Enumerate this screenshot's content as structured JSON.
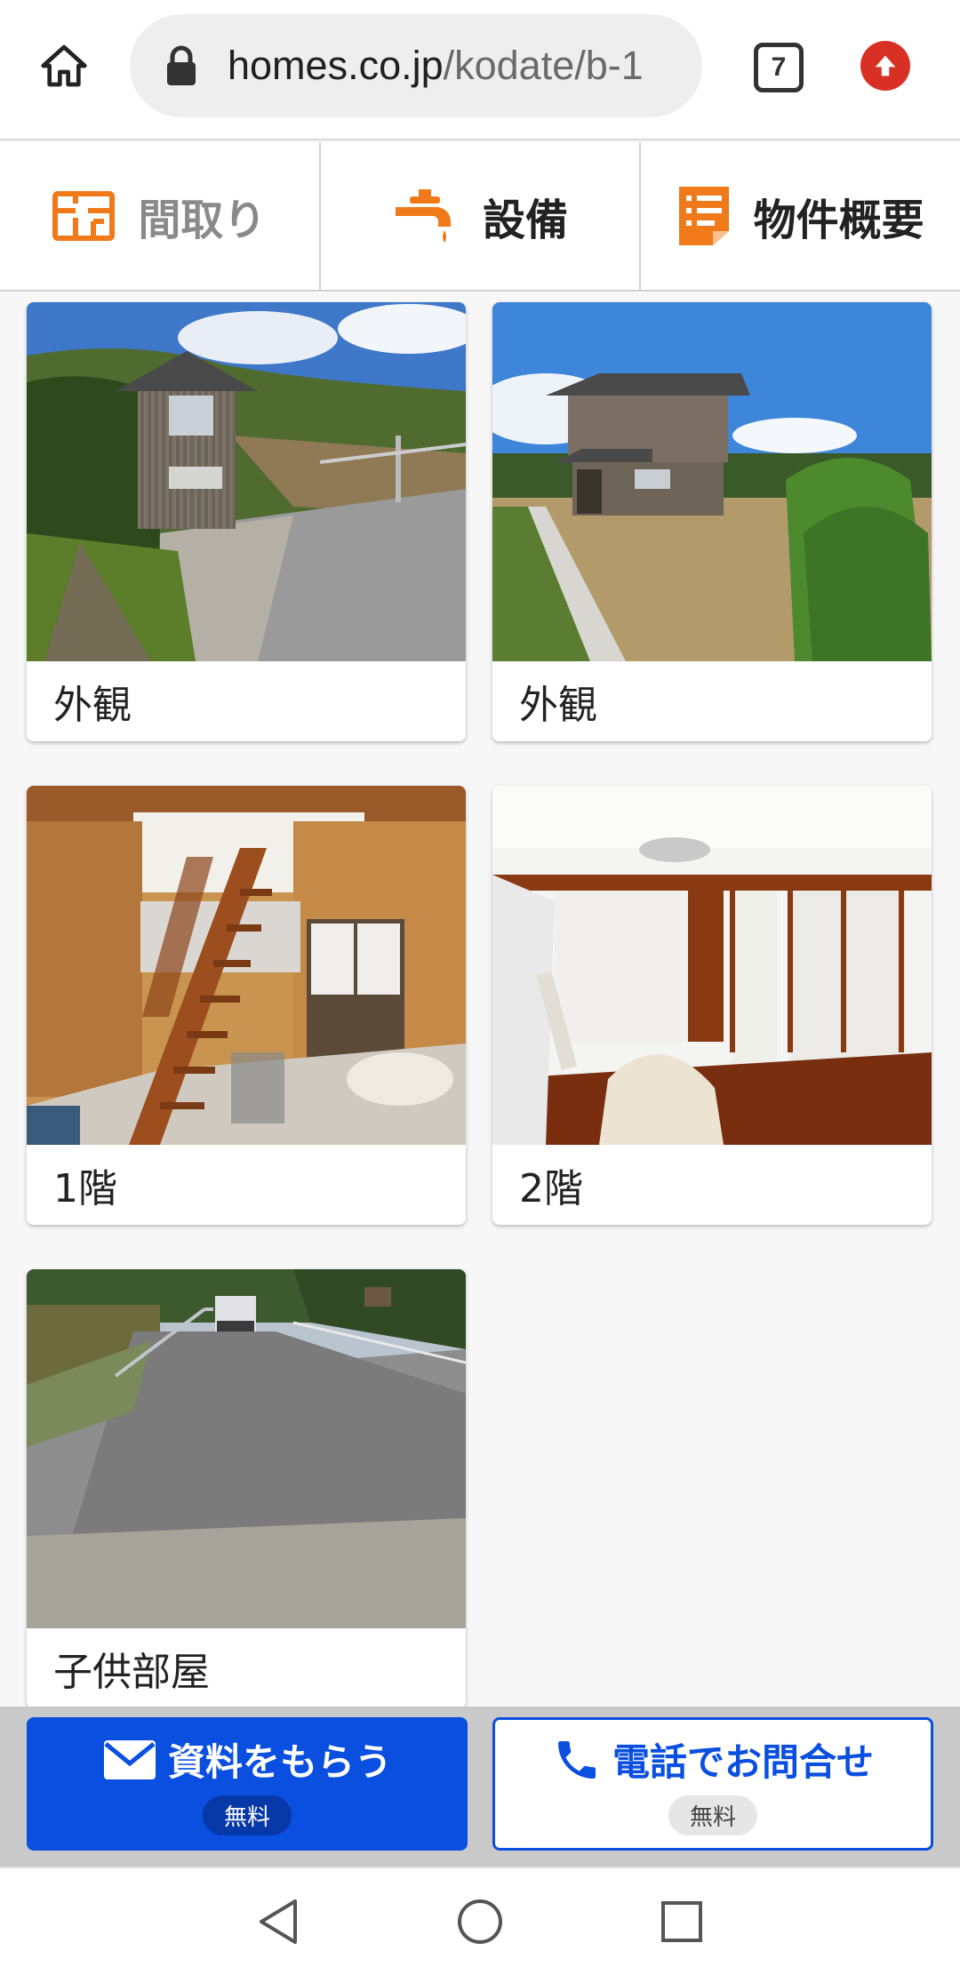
{
  "browser": {
    "url_host": "homes.co.jp",
    "url_path": "/kodate/b-1",
    "tab_count": "7"
  },
  "section_nav": [
    {
      "label": "間取り",
      "icon": "floorplan-icon"
    },
    {
      "label": "設備",
      "icon": "faucet-icon"
    },
    {
      "label": "物件概要",
      "icon": "document-list-icon"
    }
  ],
  "photos": [
    {
      "caption": "外観"
    },
    {
      "caption": "外観"
    },
    {
      "caption": "1階"
    },
    {
      "caption": "2階"
    },
    {
      "caption": "子供部屋"
    }
  ],
  "cta": {
    "request_label": "資料をもらう",
    "request_badge": "無料",
    "phone_label": "電話でお問合せ",
    "phone_badge": "無料"
  },
  "colors": {
    "accent_orange": "#f07a1a",
    "cta_blue": "#0a4fe0",
    "update_red": "#d93025"
  }
}
